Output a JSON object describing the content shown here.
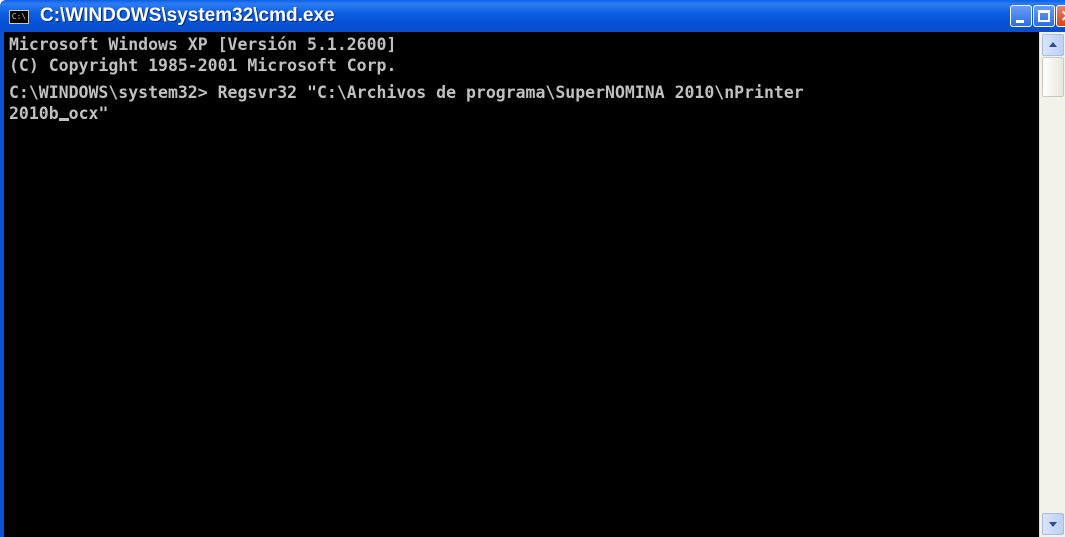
{
  "window": {
    "title": "C:\\WINDOWS\\system32\\cmd.exe",
    "icon": "cmd-console-icon",
    "icon_text": "C:\\",
    "buttons": {
      "minimize_icon": "minimize-icon",
      "maximize_icon": "maximize-icon",
      "close_label": "×"
    },
    "titlebar_color": "#0a5fe8"
  },
  "console": {
    "background": "#000000",
    "foreground": "#c0c0c0",
    "lines": [
      "Microsoft Windows XP [Versión 5.1.2600]",
      "(C) Copyright 1985-2001 Microsoft Corp."
    ],
    "command_lines": [
      "C:\\WINDOWS\\system32> Regsvr32 \"C:\\Archivos de programa\\SuperNOMINA 2010\\nPrinter",
      "2010b",
      "ocx\""
    ]
  },
  "scrollbar": {
    "up_icon": "scroll-up-arrow-icon",
    "down_icon": "scroll-down-arrow-icon"
  }
}
